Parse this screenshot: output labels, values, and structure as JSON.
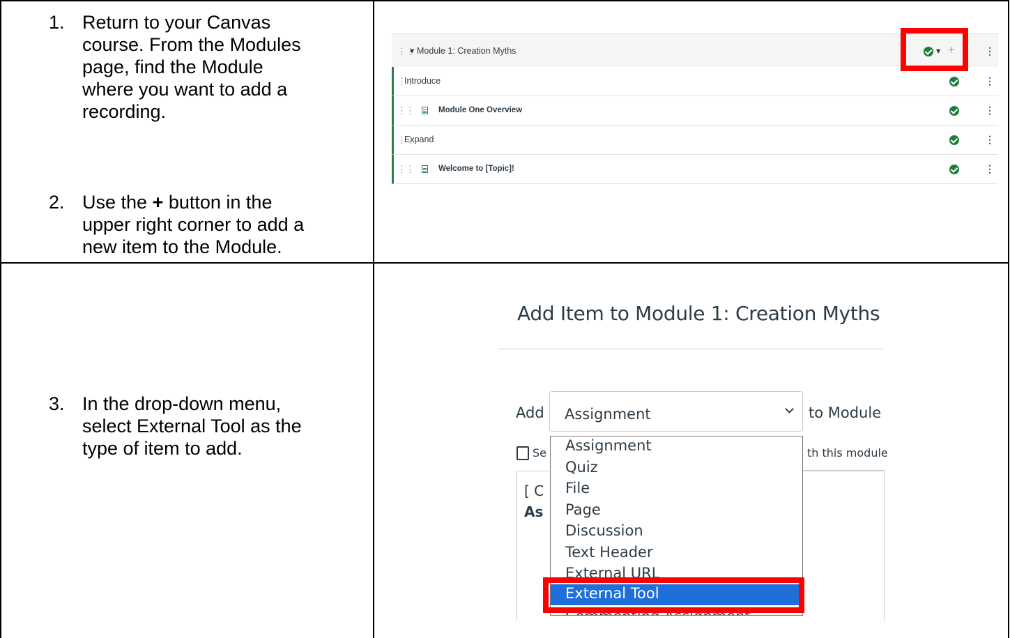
{
  "steps": [
    {
      "num": "1.",
      "lines": [
        "Return to your Canvas",
        "course. From the Modules",
        "page, find the Module",
        "where you want to add a",
        "recording."
      ]
    },
    {
      "num": "2.",
      "line1_pre": "Use the ",
      "line1_bold": "+",
      "line1_post": " button in the",
      "lines": [
        "upper right corner to add a",
        "new item to the Module."
      ]
    },
    {
      "num": "3.",
      "lines": [
        "In the drop-down menu,",
        "select External Tool as the",
        "type of item to add."
      ]
    }
  ],
  "modules": {
    "header_title": "Module 1: Creation Myths",
    "header_caret": "▾",
    "plus": "+",
    "rows": [
      {
        "type": "header",
        "label": "Introduce"
      },
      {
        "type": "item",
        "label": "Module One Overview"
      },
      {
        "type": "header",
        "label": "Expand"
      },
      {
        "type": "item",
        "label": "Welcome to [Topic]!"
      }
    ],
    "status_color": "#1e7d3a",
    "highlight_color": "#ff0000"
  },
  "dialog": {
    "title": "Add Item to Module 1: Creation Myths",
    "add_label": "Add",
    "select_value": "Assignment",
    "to_module_label": "to Module",
    "partial_left": "Se",
    "partial_right": "th this module",
    "panel_line1": "[ C",
    "panel_line2": "As",
    "options": [
      "Assignment",
      "Quiz",
      "File",
      "Page",
      "Discussion",
      "Text Header",
      "External URL",
      "External Tool"
    ],
    "selected_option": "External Tool",
    "cut_off_item": "Commenting Assignment",
    "selected_color": "#1e6fd9"
  }
}
